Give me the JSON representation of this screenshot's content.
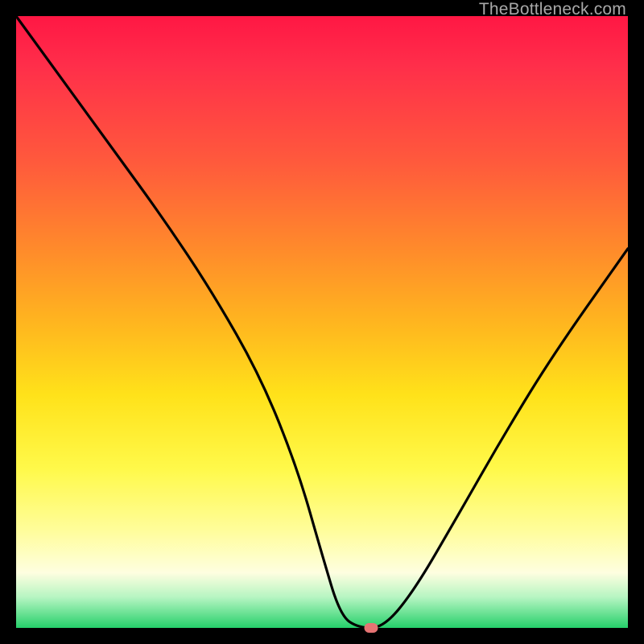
{
  "watermark": "TheBottleneck.com",
  "chart_data": {
    "type": "line",
    "title": "",
    "xlabel": "",
    "ylabel": "",
    "xlim": [
      0,
      100
    ],
    "ylim": [
      0,
      100
    ],
    "series": [
      {
        "name": "curve",
        "x": [
          0,
          8,
          16,
          24,
          32,
          40,
          46,
          50,
          53,
          56,
          60,
          65,
          72,
          80,
          88,
          100
        ],
        "values": [
          100,
          89,
          78,
          67,
          55,
          41,
          26,
          12,
          2,
          0,
          0,
          6,
          18,
          32,
          45,
          62
        ]
      }
    ],
    "marker": {
      "x": 58,
      "y": 0,
      "color": "#e57373"
    },
    "gradient_stops": [
      {
        "pos": 0,
        "color": "#ff1744"
      },
      {
        "pos": 24,
        "color": "#ff5a3c"
      },
      {
        "pos": 50,
        "color": "#ffb51f"
      },
      {
        "pos": 74,
        "color": "#fff94a"
      },
      {
        "pos": 91,
        "color": "#fefee0"
      },
      {
        "pos": 100,
        "color": "#25d06a"
      }
    ]
  }
}
